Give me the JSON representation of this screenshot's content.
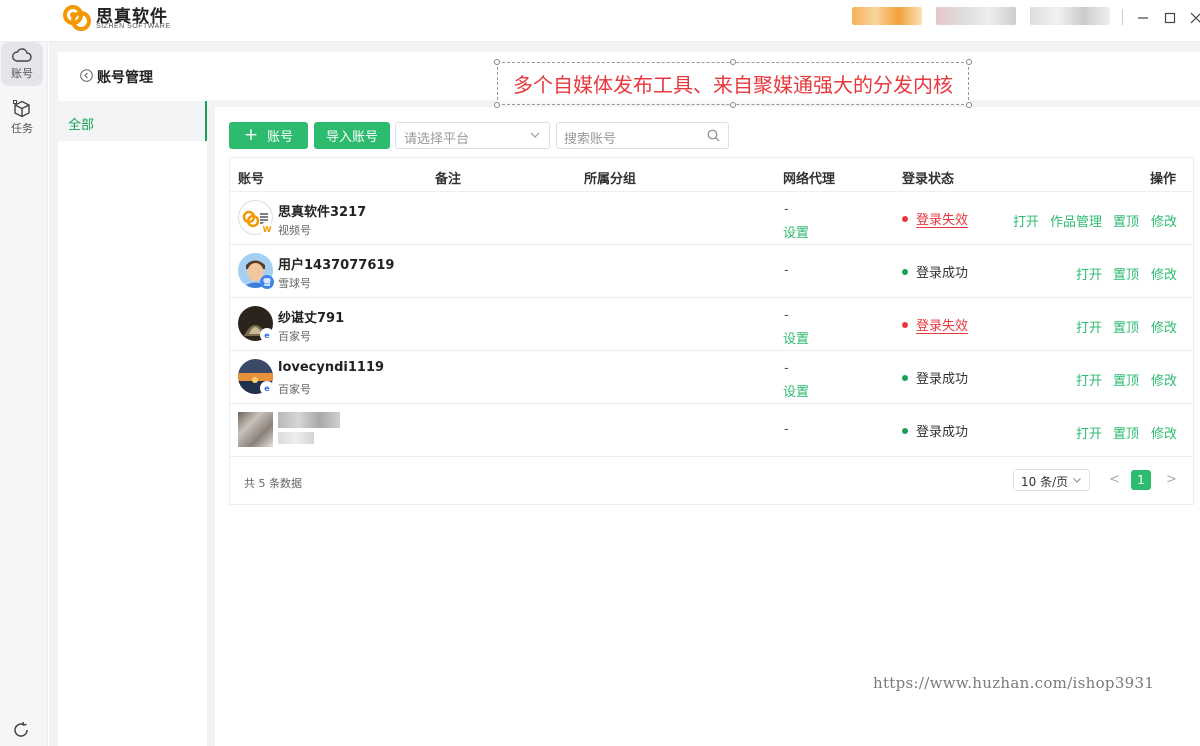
{
  "app": {
    "brand_name": "思真软件",
    "brand_sub": "SIZHEN SOFTWARE",
    "window_controls": [
      "minimize-icon",
      "maximize-icon",
      "close-icon"
    ]
  },
  "rail": {
    "items": [
      {
        "label": "账号",
        "icon": "cloud-icon",
        "active": true
      },
      {
        "label": "任务",
        "icon": "cube-icon",
        "active": false
      }
    ],
    "bottom_icon": "refresh-icon"
  },
  "header": {
    "title": "账号管理",
    "banner": "多个自媒体发布工具、来自聚媒通强大的分发内核"
  },
  "sidebar": {
    "items": [
      {
        "label": "全部"
      }
    ]
  },
  "toolbar": {
    "add_label": "账号",
    "import_label": "导入账号",
    "platform_placeholder": "请选择平台",
    "search_placeholder": "搜索账号"
  },
  "table": {
    "columns": [
      "账号",
      "备注",
      "所属分组",
      "网络代理",
      "登录状态",
      "操作"
    ],
    "rows": [
      {
        "name": "思真软件3217",
        "platform": "视频号",
        "proxy": "-",
        "proxy_action": "设置",
        "status": "登录失效",
        "status_type": "fail",
        "actions": [
          "打开",
          "作品管理",
          "置顶",
          "修改"
        ]
      },
      {
        "name": "用户1437077619",
        "platform": "雪球号",
        "proxy": "-",
        "proxy_action": "",
        "status": "登录成功",
        "status_type": "ok",
        "actions": [
          "打开",
          "置顶",
          "修改"
        ]
      },
      {
        "name": "纱谌丈791",
        "platform": "百家号",
        "proxy": "-",
        "proxy_action": "设置",
        "status": "登录失效",
        "status_type": "fail",
        "actions": [
          "打开",
          "置顶",
          "修改"
        ]
      },
      {
        "name": "lovecyndi1119",
        "platform": "百家号",
        "proxy": "-",
        "proxy_action": "设置",
        "status": "登录成功",
        "status_type": "ok",
        "actions": [
          "打开",
          "置顶",
          "修改"
        ]
      },
      {
        "name": "",
        "platform": "",
        "proxy": "-",
        "proxy_action": "",
        "status": "登录成功",
        "status_type": "ok",
        "actions": [
          "打开",
          "置顶",
          "修改"
        ]
      }
    ]
  },
  "pagination": {
    "total_text": "共 5 条数据",
    "page_size": "10 条/页",
    "current_page": "1",
    "prev": "<",
    "next": ">"
  },
  "watermark": "https://www.huzhan.com/ishop3931",
  "colors": {
    "accent": "#2dbb6f",
    "danger": "#e8383d",
    "success_dot": "#18a058"
  }
}
